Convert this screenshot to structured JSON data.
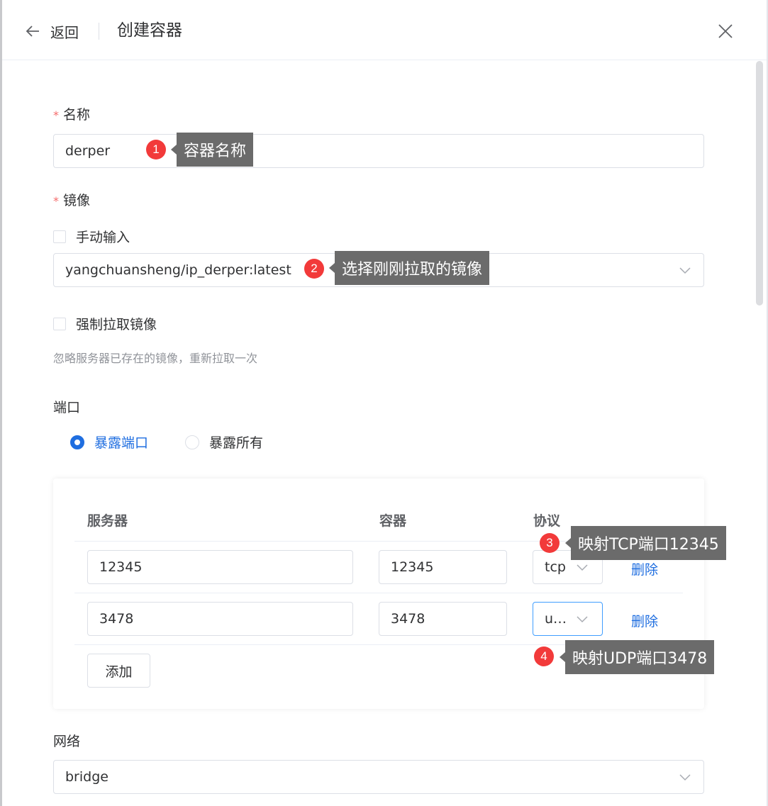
{
  "header": {
    "back_label": "返回",
    "title": "创建容器"
  },
  "form": {
    "name": {
      "label": "名称",
      "value": "derper"
    },
    "image": {
      "label": "镜像",
      "manual_input_label": "手动输入",
      "selected": "yangchuansheng/ip_derper:latest",
      "force_pull_label": "强制拉取镜像",
      "force_pull_hint": "忽略服务器已存在的镜像，重新拉取一次"
    },
    "ports": {
      "label": "端口",
      "mode_expose": "暴露端口",
      "mode_all": "暴露所有",
      "columns": {
        "server": "服务器",
        "container": "容器",
        "protocol": "协议"
      },
      "rows": [
        {
          "server": "12345",
          "container": "12345",
          "protocol": "tcp",
          "delete": "删除"
        },
        {
          "server": "3478",
          "container": "3478",
          "protocol": "u…",
          "delete": "删除"
        }
      ],
      "add_label": "添加"
    },
    "network": {
      "label": "网络",
      "value": "bridge"
    }
  },
  "annotations": [
    {
      "number": "1",
      "text": "容器名称"
    },
    {
      "number": "2",
      "text": "选择刚刚拉取的镜像"
    },
    {
      "number": "3",
      "text": "映射TCP端口12345"
    },
    {
      "number": "4",
      "text": "映射UDP端口3478"
    }
  ],
  "colors": {
    "primary": "#1f6ee0",
    "required": "#f56c6c",
    "badge": "#f23a3a",
    "tooltip": "#6b6b6b"
  }
}
